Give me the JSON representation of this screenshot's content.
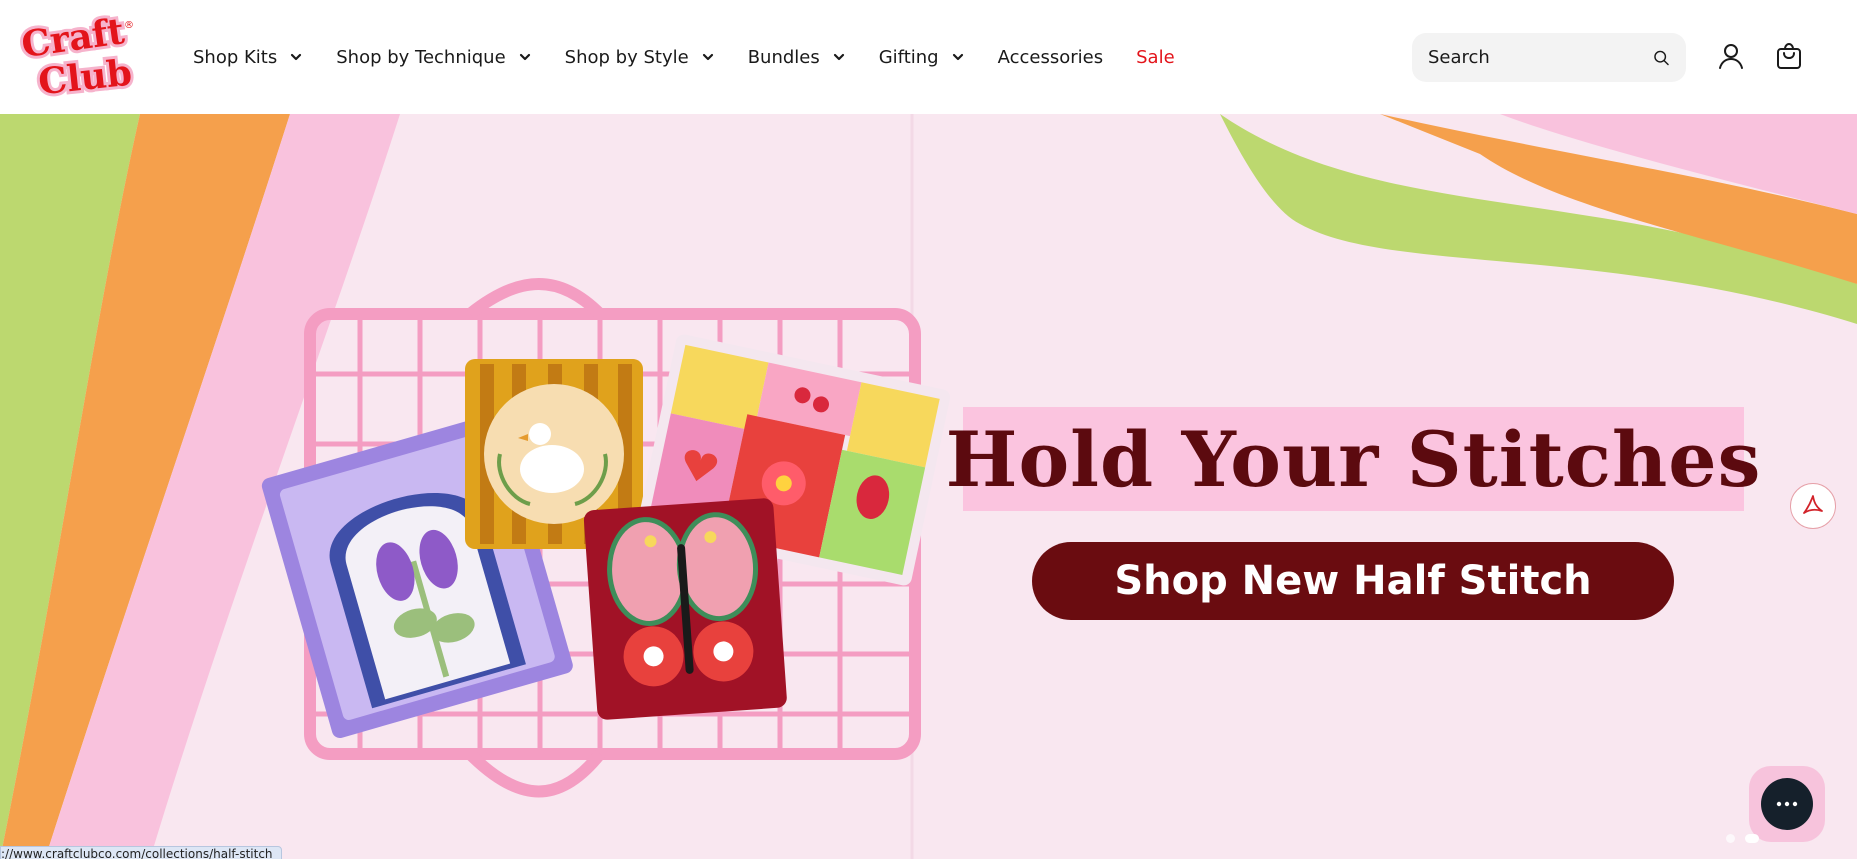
{
  "brand": {
    "logo_text_line1": "Craft",
    "logo_text_line2": "Club",
    "registered": "®"
  },
  "nav": {
    "items": [
      {
        "label": "Shop Kits",
        "has_dropdown": true
      },
      {
        "label": "Shop by Technique",
        "has_dropdown": true
      },
      {
        "label": "Shop by Style",
        "has_dropdown": true
      },
      {
        "label": "Bundles",
        "has_dropdown": true
      },
      {
        "label": "Gifting",
        "has_dropdown": true
      },
      {
        "label": "Accessories",
        "has_dropdown": false
      },
      {
        "label": "Sale",
        "has_dropdown": false
      }
    ]
  },
  "search": {
    "placeholder": "Search",
    "icon": "search-icon"
  },
  "header_icons": {
    "account": "user-icon",
    "cart": "bag-icon"
  },
  "hero": {
    "headline": "Hold Your Stitches",
    "cta_label": "Shop New Half Stitch",
    "colors": {
      "background": "#f9e7f0",
      "band": "#fbc4df",
      "headline": "#5c0a0f",
      "cta": "#6a0c10",
      "green": "#bcd86f",
      "orange": "#f5a04c",
      "pink": "#f9c2dd"
    }
  },
  "floating": {
    "pdf_icon": "acrobat-icon",
    "chat_icon": "chat-bubble-icon"
  },
  "carousel": {
    "slide_count": 2,
    "active_index": 1
  },
  "status_url": "://www.craftclubco.com/collections/half-stitch"
}
